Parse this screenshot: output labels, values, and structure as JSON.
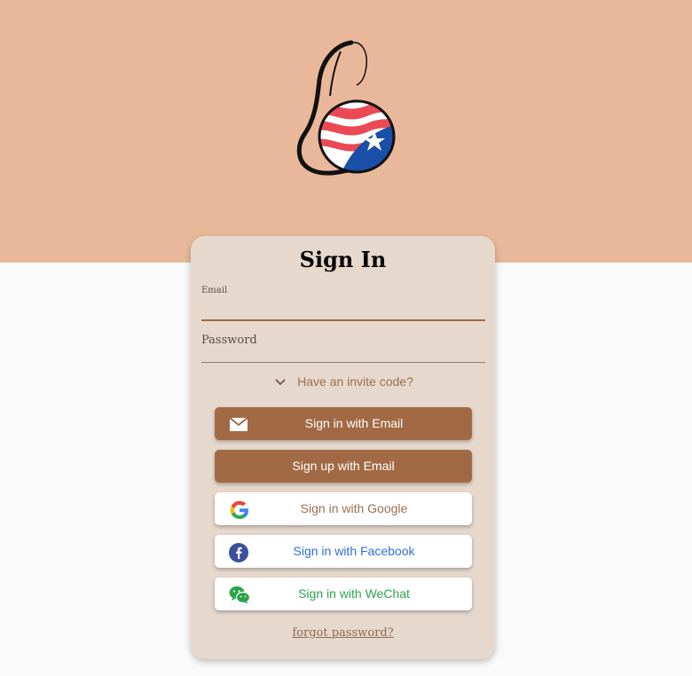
{
  "header": {
    "band_color": "#e9b89a",
    "logo_icon": "pregnant-woman-flag-logo"
  },
  "card": {
    "title": "Sign In",
    "email_field": {
      "label": "Email",
      "value": ""
    },
    "password_field": {
      "label": "Password",
      "value": ""
    },
    "invite_toggle": {
      "label": "Have an invite code?",
      "icon": "chevron-down-icon"
    },
    "buttons": {
      "email": {
        "label": "Sign in with Email",
        "icon": "mail-icon",
        "color": "#a26a44"
      },
      "signup": {
        "label": "Sign up with Email",
        "color": "#a26a44"
      },
      "google": {
        "label": "Sign in with Google",
        "icon": "google-icon"
      },
      "facebook": {
        "label": "Sign in with Facebook",
        "icon": "facebook-icon",
        "color": "#2f6fd6"
      },
      "wechat": {
        "label": "Sign in with WeChat",
        "icon": "wechat-icon",
        "color": "#2aa44a"
      }
    },
    "forgot_label": "forgot password?"
  }
}
